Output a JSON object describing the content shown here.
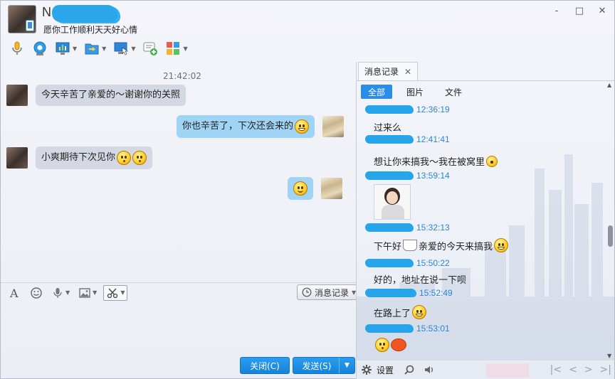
{
  "header": {
    "contact_name": "N",
    "status_message": "愿你工作顺利天天好心情",
    "controls": [
      "-",
      "□",
      "✕"
    ]
  },
  "toolbar": {
    "items": [
      {
        "icon": "microphone-icon",
        "has_menu": false
      },
      {
        "icon": "video-camera-icon",
        "has_menu": false
      },
      {
        "icon": "screen-share-icon",
        "has_menu": true
      },
      {
        "icon": "file-transfer-icon",
        "has_menu": true
      },
      {
        "icon": "remote-desktop-icon",
        "has_menu": true
      },
      {
        "icon": "create-group-icon",
        "has_menu": false
      },
      {
        "icon": "apps-icon",
        "has_menu": true
      }
    ]
  },
  "chat": {
    "timestamp": "21:42:02",
    "messages": [
      {
        "from": "other",
        "text": "今天辛苦了亲爱的～谢谢你的关照",
        "emojis": []
      },
      {
        "from": "self",
        "text": "你也辛苦了，下次还会来的",
        "emojis": [
          "grin"
        ]
      },
      {
        "from": "other",
        "text": "小爽期待下次见你",
        "emojis": [
          "kiss",
          "kiss"
        ]
      },
      {
        "from": "self",
        "text": "",
        "emojis": [
          "smile"
        ]
      }
    ]
  },
  "input_toolbar": {
    "history_label": "消息记录",
    "items": [
      "font-icon",
      "emoji-icon",
      "voice-message-icon",
      "image-icon",
      "screenshot-scissors-icon"
    ]
  },
  "buttons": {
    "close_label": "关闭(C)",
    "send_label": "发送(S)"
  },
  "side_panel": {
    "tab_label": "消息记录",
    "filters": [
      "全部",
      "图片",
      "文件"
    ],
    "active_filter": "全部",
    "log": [
      {
        "time": "12:36:19",
        "text": "过来么",
        "emojis": []
      },
      {
        "time": "12:41:41",
        "text": "想让你来搞我～我在被窝里",
        "emojis": [
          "flex"
        ]
      },
      {
        "time": "13:59:14",
        "text": "",
        "image": true
      },
      {
        "time": "15:32:13",
        "text": "下午好",
        "text2": "亲爱的今天来搞我",
        "emojis": [
          "coffee",
          "heart-eyes"
        ]
      },
      {
        "time": "15:50:22",
        "text": "好的，地址在说一下呗",
        "emojis": []
      },
      {
        "time": "15:52:49",
        "text": "在路上了",
        "emojis": [
          "grin"
        ]
      },
      {
        "time": "15:53:01",
        "text": "",
        "emojis": [
          "kiss",
          "egg"
        ]
      }
    ],
    "settings_label": "设置",
    "time_color": "#2c86cf"
  },
  "colors": {
    "accent": "#2a8ee8",
    "self_bubble": "#9fd4f5",
    "other_bubble": "#d4d8e2"
  }
}
